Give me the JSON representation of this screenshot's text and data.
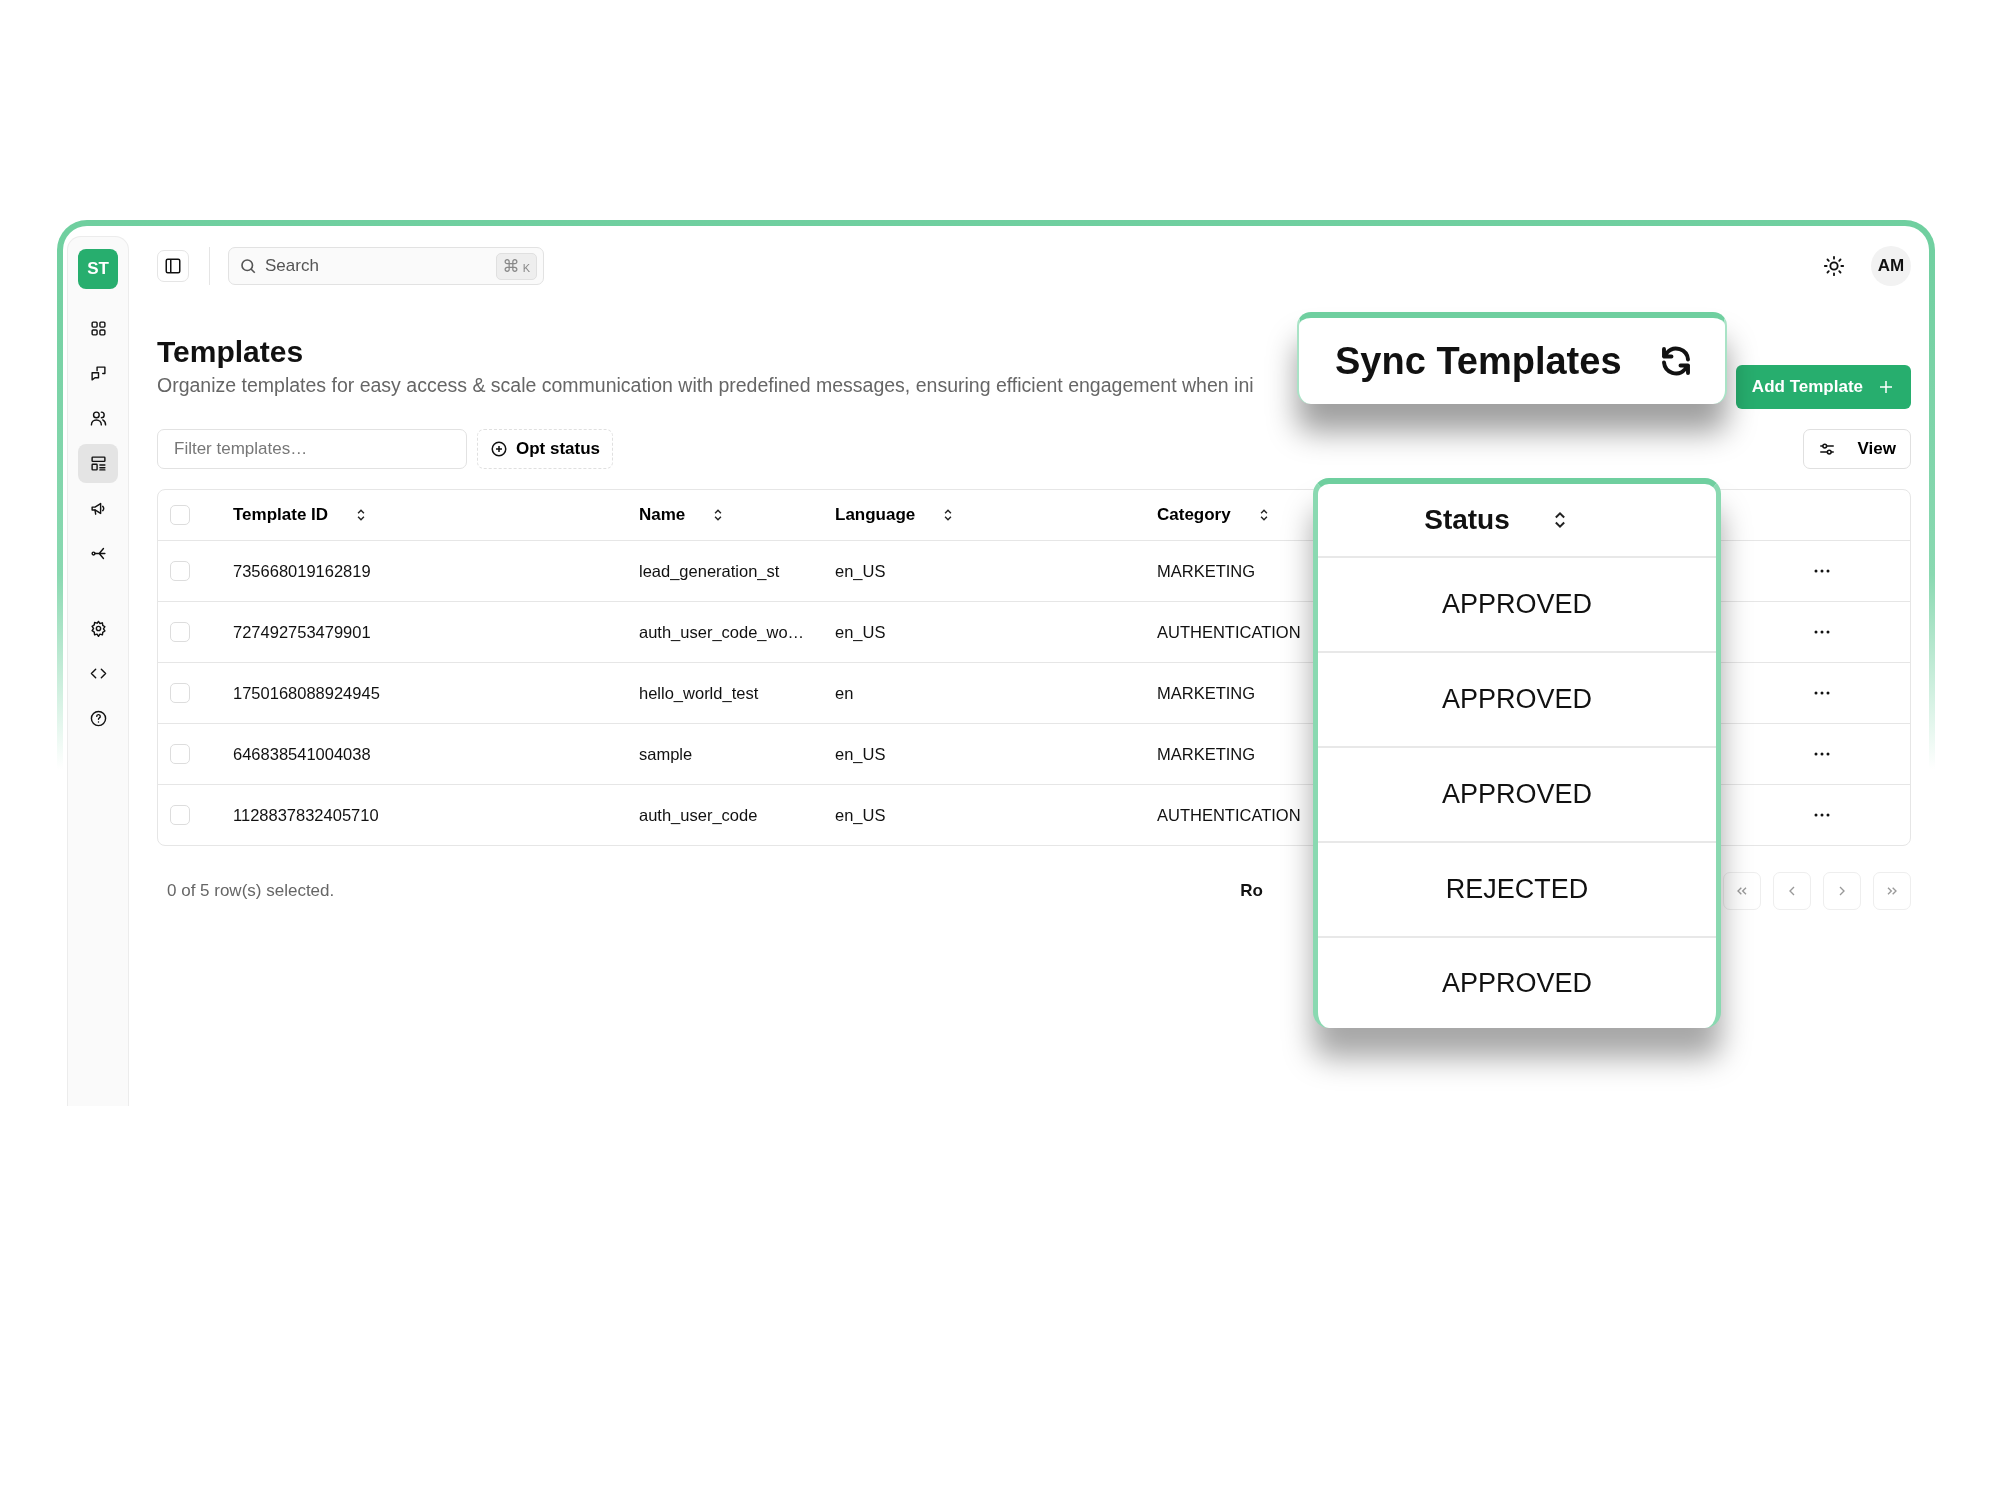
{
  "sidebar": {
    "logo": "ST",
    "items": [
      {
        "selected": false
      },
      {
        "selected": false
      },
      {
        "selected": false
      },
      {
        "selected": true
      },
      {
        "selected": false
      },
      {
        "selected": false
      },
      {
        "selected": false
      },
      {
        "selected": false
      },
      {
        "selected": false
      }
    ]
  },
  "header": {
    "search": {
      "placeholder": "Search",
      "shortcut": [
        "⌘",
        "K"
      ]
    },
    "avatar": "AM"
  },
  "page": {
    "title": "Templates",
    "subtitle": "Organize templates for easy access & scale communication with predefined messages, ensuring efficient engagement when ini"
  },
  "actions": {
    "sync": "Sync Templates",
    "add": "Add Template"
  },
  "toolbar": {
    "filter": {
      "placeholder": "Filter templates…"
    },
    "opt_status": "Opt status",
    "view": "View"
  },
  "table": {
    "header_checked": false,
    "columns": [
      "Template ID",
      "Name",
      "Language",
      "Category"
    ],
    "status_column": "Status",
    "rows": [
      {
        "checked": false,
        "id": "735668019162819",
        "name": "lead_generation_st",
        "language": "en_US",
        "category": "MARKETING",
        "status": "APPROVED"
      },
      {
        "checked": false,
        "id": "727492753479901",
        "name": "auth_user_code_wo…",
        "language": "en_US",
        "category": "AUTHENTICATION",
        "status": "APPROVED"
      },
      {
        "checked": false,
        "id": "1750168088924945",
        "name": "hello_world_test",
        "language": "en",
        "category": "MARKETING",
        "status": "APPROVED"
      },
      {
        "checked": false,
        "id": "646838541004038",
        "name": "sample",
        "language": "en_US",
        "category": "MARKETING",
        "status": "REJECTED"
      },
      {
        "checked": false,
        "id": "1128837832405710",
        "name": "auth_user_code",
        "language": "en_US",
        "category": "AUTHENTICATION",
        "status": "APPROVED"
      }
    ]
  },
  "footer": {
    "selection": "0 of 5 row(s) selected.",
    "rows_label": "Ro"
  }
}
